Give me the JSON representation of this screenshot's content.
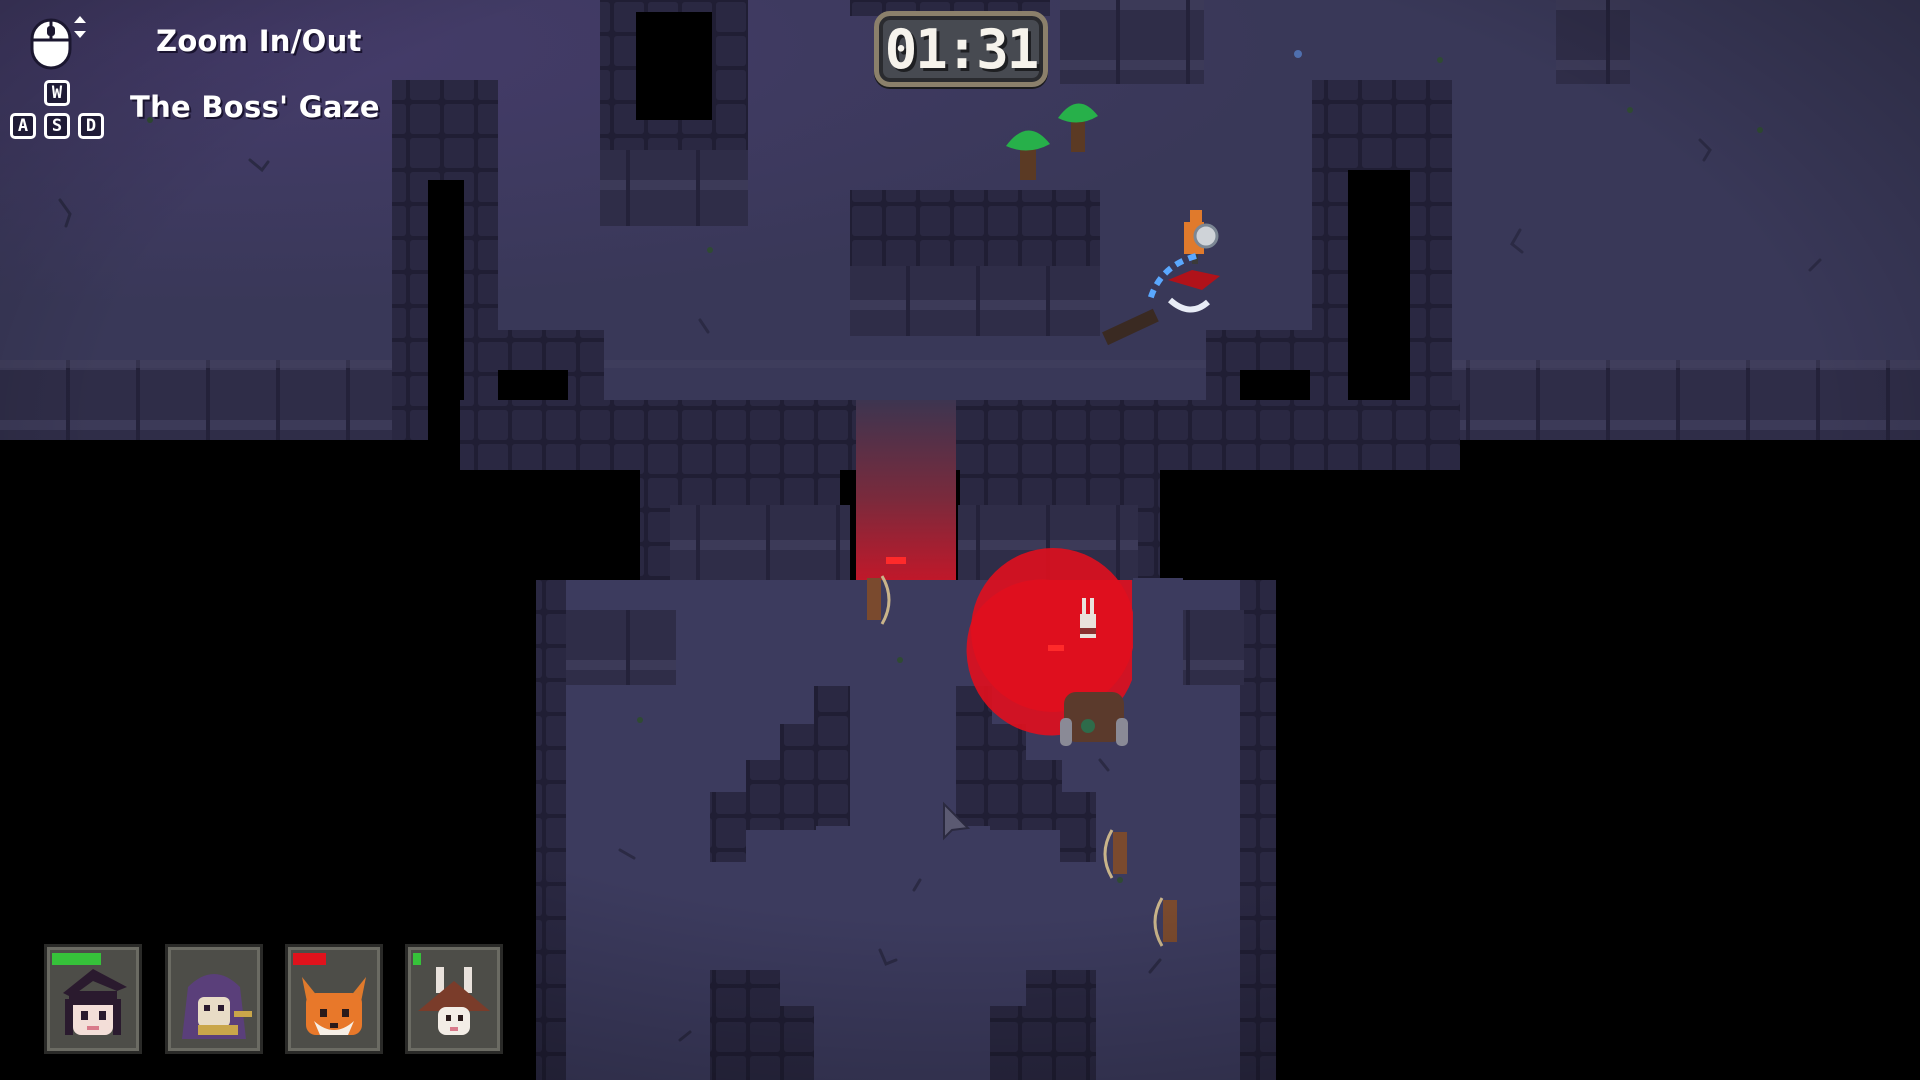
{
  "hud": {
    "timer": "01:31",
    "hints": [
      {
        "label": "Zoom In/Out",
        "icon": "mouse-wheel-icon"
      },
      {
        "label": "The Boss' Gaze",
        "icon": "wasd-keys-icon"
      }
    ],
    "keys": {
      "w": "W",
      "a": "A",
      "s": "S",
      "d": "D"
    }
  },
  "party": [
    {
      "character": "witch",
      "hp_fraction": 0.6,
      "bar_color": "#36c23a"
    },
    {
      "character": "purple-hooded-mage",
      "hp_fraction": 0.0,
      "bar_color": "#36c23a"
    },
    {
      "character": "fox",
      "hp_fraction": 0.4,
      "bar_color": "#e0121c"
    },
    {
      "character": "rabbit-wizard",
      "hp_fraction": 0.1,
      "bar_color": "#36c23a"
    }
  ],
  "colors": {
    "floor": "#3b3a5c",
    "wall": "#26243c",
    "boss_gaze": "#e0101e"
  }
}
